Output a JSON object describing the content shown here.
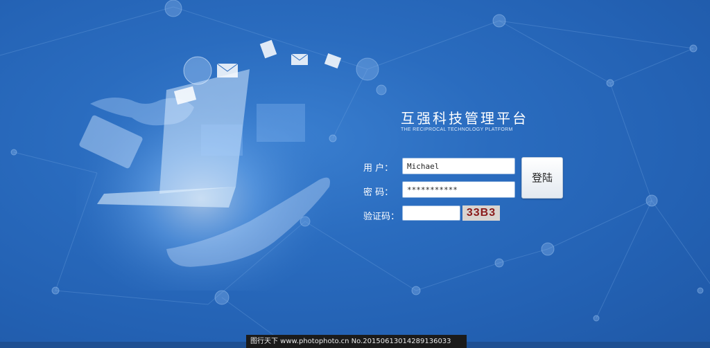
{
  "brand": {
    "title": "互强科技管理平台",
    "subtitle": "THE RECIPROCAL TECHNOLOGY PLATFORM"
  },
  "form": {
    "username_label": "用  户：",
    "username_value": "Michael",
    "password_label": "密  码：",
    "password_value": "***********",
    "captcha_label": "验证码：",
    "captcha_value": "",
    "captcha_text": "33B3",
    "login_label": "登陆"
  },
  "footer": {
    "watermark": "图行天下 www.photophoto.cn  No.20150613014289136033"
  },
  "colors": {
    "background": "#2a6cbf",
    "text": "#ffffff",
    "captcha_text": "#8a1a1a"
  }
}
